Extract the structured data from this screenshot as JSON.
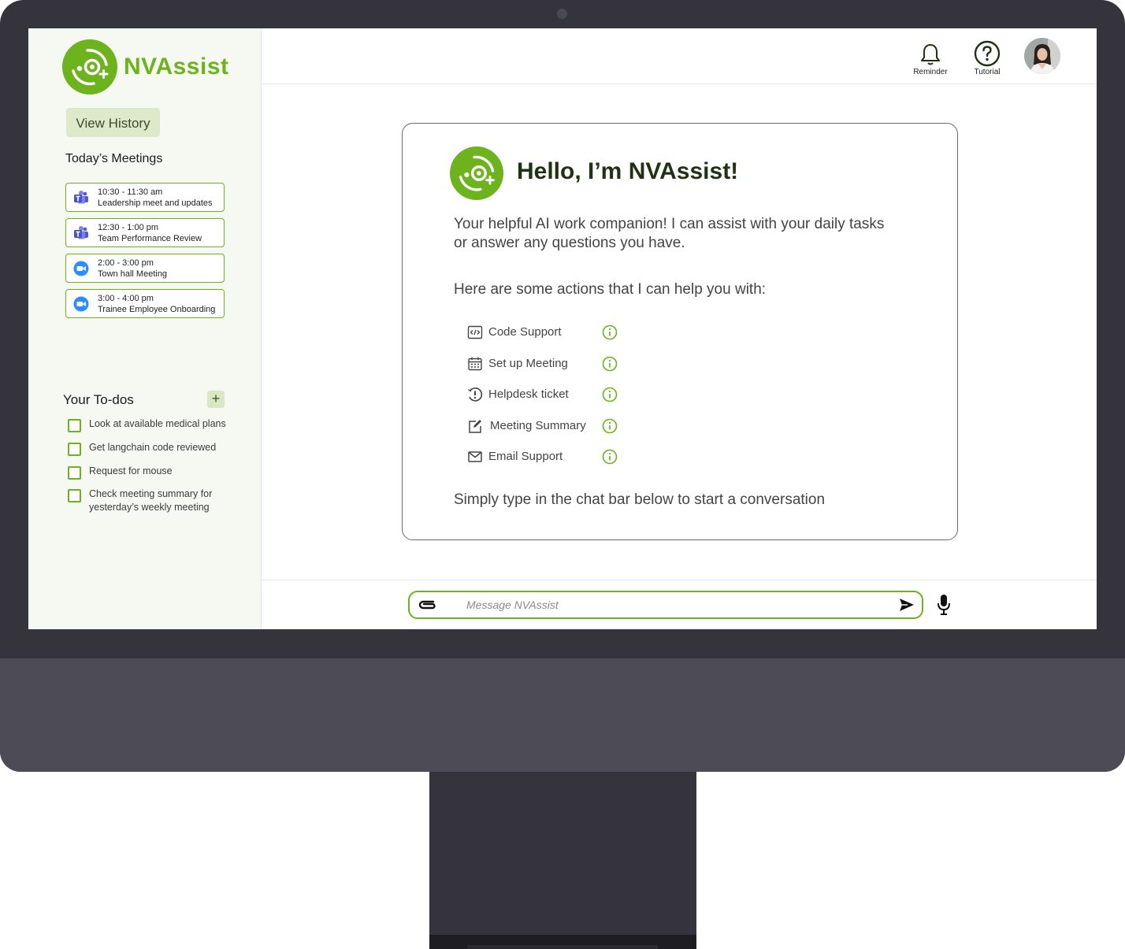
{
  "brand": {
    "name": "NVAssist",
    "accent": "#6cb31d",
    "dark_green": "#1f3314"
  },
  "sidebar": {
    "view_history": "View History",
    "meetings_title": "Today’s Meetings",
    "meetings": [
      {
        "time": "10:30 - 11:30 am",
        "title": "Leadership meet and updates",
        "icon": "teams-icon"
      },
      {
        "time": "12:30 - 1:00 pm",
        "title": "Team Performance Review",
        "icon": "teams-icon"
      },
      {
        "time": "2:00 - 3:00 pm",
        "title": "Town hall Meeting",
        "icon": "zoom-icon"
      },
      {
        "time": "3:00 - 4:00 pm",
        "title": "Trainee Employee Onboarding",
        "icon": "zoom-icon"
      }
    ],
    "todos_title": "Your To-dos",
    "todos_add": "+",
    "todos": [
      "Look at available medical plans",
      "Get langchain code reviewed",
      "Request for mouse",
      "Check meeting summary for yesterday’s weekly meeting"
    ]
  },
  "header": {
    "reminder": "Reminder",
    "tutorial": "Tutorial"
  },
  "main": {
    "greeting": "Hello, I’m NVAssist!",
    "intro": "Your helpful AI work companion! I can assist with your daily tasks or answer any questions you have.",
    "actions_intro": "Here are some actions that I can help you with:",
    "actions": [
      {
        "label": "Code Support",
        "icon": "code-icon"
      },
      {
        "label": "Set up Meeting",
        "icon": "calendar-icon"
      },
      {
        "label": "Helpdesk ticket",
        "icon": "helpdesk-icon"
      },
      {
        "label": "Meeting Summary",
        "icon": "edit-note-icon"
      },
      {
        "label": "Email Support",
        "icon": "mail-icon"
      }
    ],
    "footer": "Simply type in the chat bar below to start a conversation"
  },
  "chat": {
    "placeholder": "Message NVAssist"
  }
}
